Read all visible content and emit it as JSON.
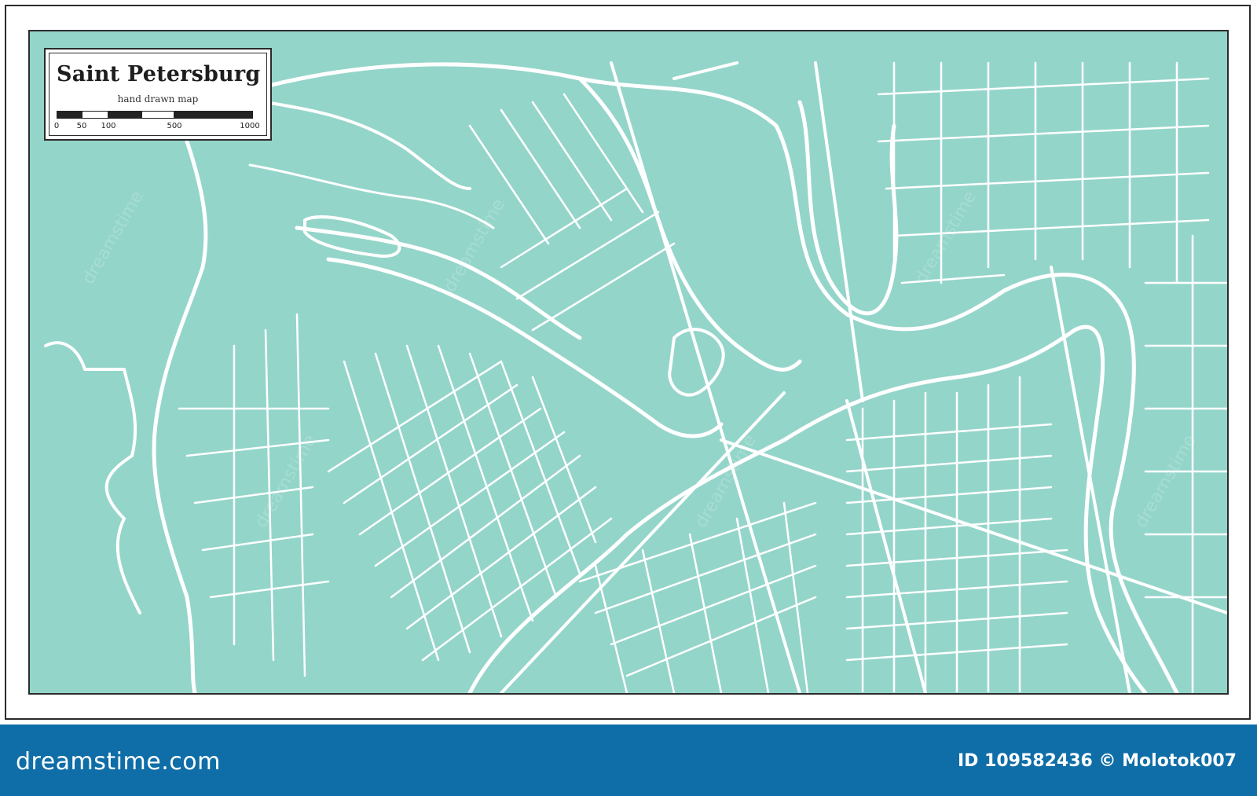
{
  "map": {
    "title": "Saint Petersburg",
    "subtitle": "hand drawn map",
    "scale_labels": [
      "0",
      "50",
      "100",
      "500",
      "1000"
    ],
    "colors": {
      "water": "#94d5ca",
      "land": "#94d5ca",
      "streets": "#ffffff",
      "frame": "#2b2b2b"
    }
  },
  "footer": {
    "brand": "dreamstime.com",
    "credit": "ID 109582436 © Molotok007",
    "background": "#0f6ea7"
  },
  "watermark": {
    "text": "dreamstime"
  }
}
